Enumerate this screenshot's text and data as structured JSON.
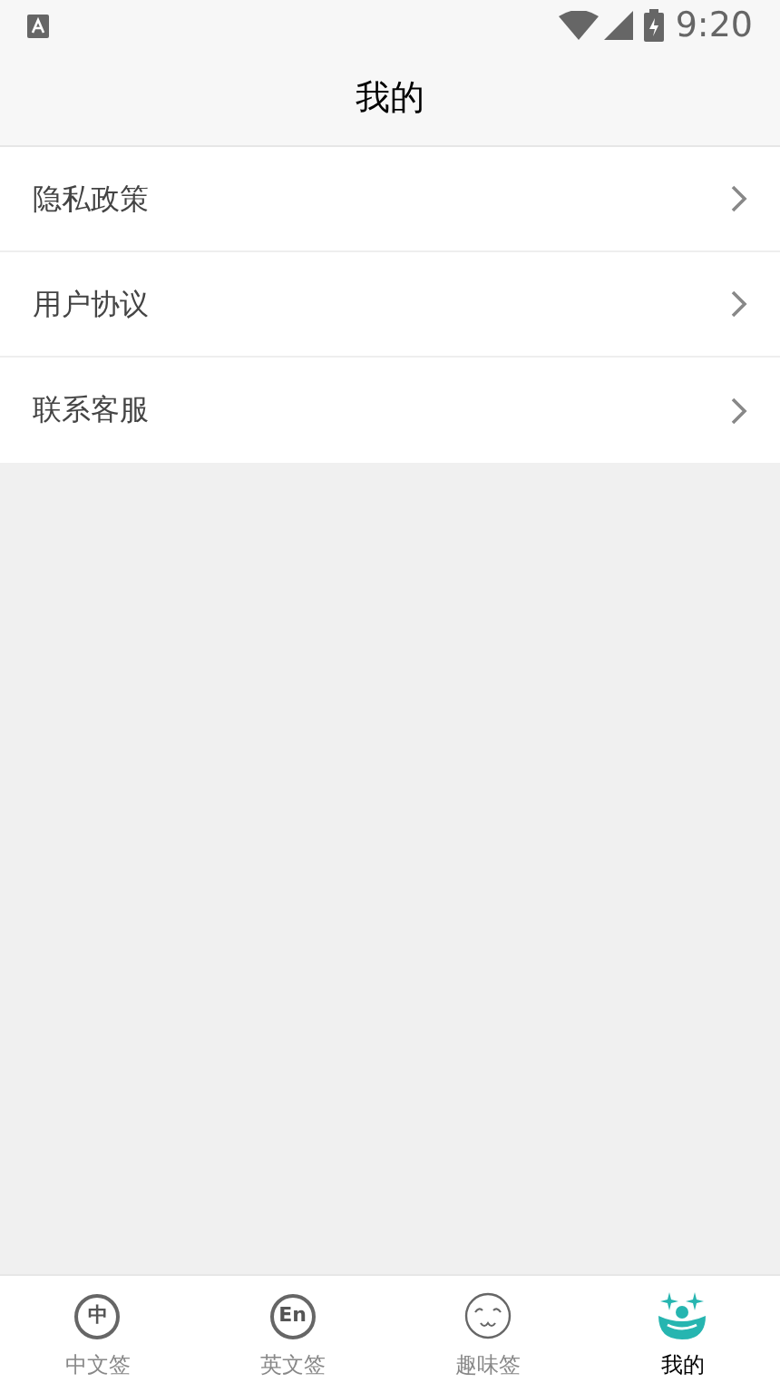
{
  "status_bar": {
    "time": "9:20"
  },
  "header": {
    "title": "我的"
  },
  "menu": [
    {
      "label": "隐私政策"
    },
    {
      "label": "用户协议"
    },
    {
      "label": "联系客服"
    }
  ],
  "tabs": [
    {
      "label": "中文签",
      "kind": "glyph",
      "glyph": "中",
      "selected": false
    },
    {
      "label": "英文签",
      "kind": "glyph",
      "glyph": "En",
      "selected": false
    },
    {
      "label": "趣味签",
      "kind": "face",
      "selected": false
    },
    {
      "label": "我的",
      "kind": "clown",
      "selected": true
    }
  ]
}
